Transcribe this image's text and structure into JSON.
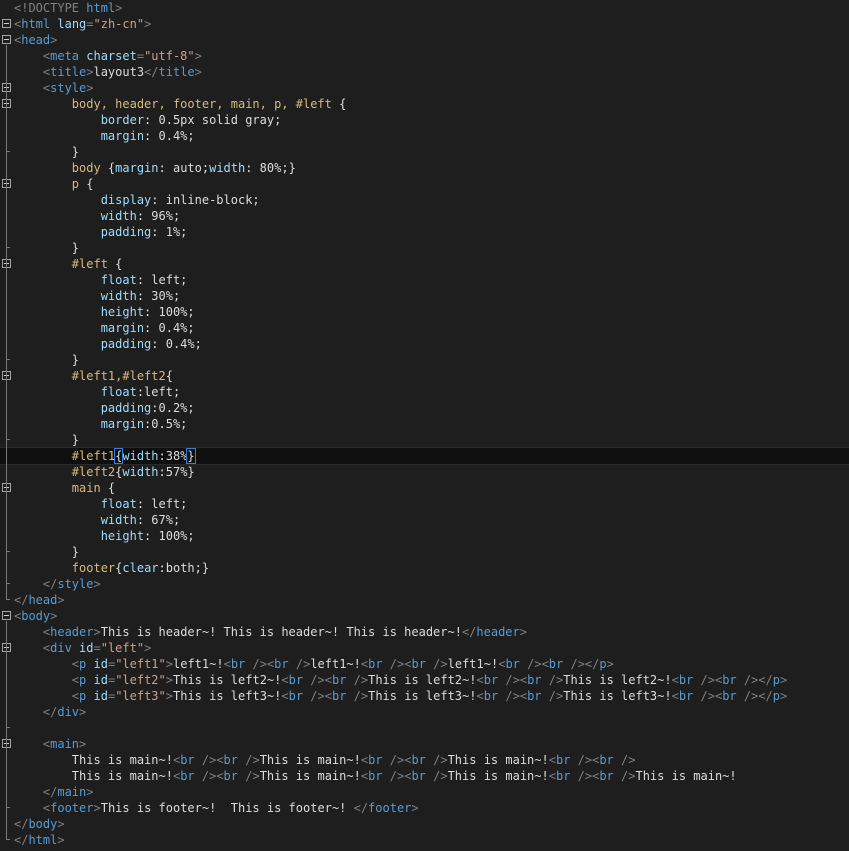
{
  "editor": {
    "lines": [
      [
        {
          "t": "<!DOCTYPE ",
          "c": "tok-punct"
        },
        {
          "t": "html",
          "c": "tok-tag"
        },
        {
          "t": ">",
          "c": "tok-punct"
        }
      ],
      [
        {
          "t": "<",
          "c": "tok-punct"
        },
        {
          "t": "html",
          "c": "tok-tag"
        },
        {
          "t": " lang",
          "c": "tok-attr"
        },
        {
          "t": "=",
          "c": "tok-punct"
        },
        {
          "t": "\"zh-cn\"",
          "c": "tok-str"
        },
        {
          "t": ">",
          "c": "tok-punct"
        }
      ],
      [
        {
          "t": "<",
          "c": "tok-punct"
        },
        {
          "t": "head",
          "c": "tok-tag"
        },
        {
          "t": ">",
          "c": "tok-punct"
        }
      ],
      [
        {
          "t": "    <",
          "c": "tok-punct"
        },
        {
          "t": "meta",
          "c": "tok-tag"
        },
        {
          "t": " charset",
          "c": "tok-attr"
        },
        {
          "t": "=",
          "c": "tok-punct"
        },
        {
          "t": "\"utf-8\"",
          "c": "tok-str"
        },
        {
          "t": ">",
          "c": "tok-punct"
        }
      ],
      [
        {
          "t": "    <",
          "c": "tok-punct"
        },
        {
          "t": "title",
          "c": "tok-tag"
        },
        {
          "t": ">",
          "c": "tok-punct"
        },
        {
          "t": "layout3",
          "c": "tok-text"
        },
        {
          "t": "</",
          "c": "tok-punct"
        },
        {
          "t": "title",
          "c": "tok-tag"
        },
        {
          "t": ">",
          "c": "tok-punct"
        }
      ],
      [
        {
          "t": "    <",
          "c": "tok-punct"
        },
        {
          "t": "style",
          "c": "tok-tag"
        },
        {
          "t": ">",
          "c": "tok-punct"
        }
      ],
      [
        {
          "t": "        body, header, footer, main, p, #left ",
          "c": "tok-sel"
        },
        {
          "t": "{",
          "c": "tok-val"
        }
      ],
      [
        {
          "t": "            border",
          "c": "tok-prop"
        },
        {
          "t": ": 0.5px solid gray;",
          "c": "tok-val"
        }
      ],
      [
        {
          "t": "            margin",
          "c": "tok-prop"
        },
        {
          "t": ": 0.4%;",
          "c": "tok-val"
        }
      ],
      [
        {
          "t": "        }",
          "c": "tok-val"
        }
      ],
      [
        {
          "t": "        body ",
          "c": "tok-sel"
        },
        {
          "t": "{",
          "c": "tok-val"
        },
        {
          "t": "margin",
          "c": "tok-prop"
        },
        {
          "t": ": auto;",
          "c": "tok-val"
        },
        {
          "t": "width",
          "c": "tok-prop"
        },
        {
          "t": ": 80%;}",
          "c": "tok-val"
        }
      ],
      [
        {
          "t": "        p ",
          "c": "tok-sel"
        },
        {
          "t": "{",
          "c": "tok-val"
        }
      ],
      [
        {
          "t": "            display",
          "c": "tok-prop"
        },
        {
          "t": ": inline-block;",
          "c": "tok-val"
        }
      ],
      [
        {
          "t": "            width",
          "c": "tok-prop"
        },
        {
          "t": ": 96%;",
          "c": "tok-val"
        }
      ],
      [
        {
          "t": "            padding",
          "c": "tok-prop"
        },
        {
          "t": ": 1%;",
          "c": "tok-val"
        }
      ],
      [
        {
          "t": "        }",
          "c": "tok-val"
        }
      ],
      [
        {
          "t": "        #left ",
          "c": "tok-sel"
        },
        {
          "t": "{",
          "c": "tok-val"
        }
      ],
      [
        {
          "t": "            float",
          "c": "tok-prop"
        },
        {
          "t": ": left;",
          "c": "tok-val"
        }
      ],
      [
        {
          "t": "            width",
          "c": "tok-prop"
        },
        {
          "t": ": 30%;",
          "c": "tok-val"
        }
      ],
      [
        {
          "t": "            height",
          "c": "tok-prop"
        },
        {
          "t": ": 100%;",
          "c": "tok-val"
        }
      ],
      [
        {
          "t": "            margin",
          "c": "tok-prop"
        },
        {
          "t": ": 0.4%;",
          "c": "tok-val"
        }
      ],
      [
        {
          "t": "            padding",
          "c": "tok-prop"
        },
        {
          "t": ": 0.4%;",
          "c": "tok-val"
        }
      ],
      [
        {
          "t": "        }",
          "c": "tok-val"
        }
      ],
      [
        {
          "t": "        #left1,#left2",
          "c": "tok-sel"
        },
        {
          "t": "{",
          "c": "tok-val"
        }
      ],
      [
        {
          "t": "            float",
          "c": "tok-prop"
        },
        {
          "t": ":left;",
          "c": "tok-val"
        }
      ],
      [
        {
          "t": "            padding",
          "c": "tok-prop"
        },
        {
          "t": ":0.2%;",
          "c": "tok-val"
        }
      ],
      [
        {
          "t": "            margin",
          "c": "tok-prop"
        },
        {
          "t": ":0.5%;",
          "c": "tok-val"
        }
      ],
      [
        {
          "t": "        }",
          "c": "tok-val"
        }
      ],
      [
        {
          "t": "        #left1",
          "c": "tok-sel"
        },
        {
          "t": "{",
          "c": "tok-val tok-brace-hl"
        },
        {
          "t": "width",
          "c": "tok-prop"
        },
        {
          "t": ":38%",
          "c": "tok-val"
        },
        {
          "t": "}",
          "c": "tok-val tok-brace-hl"
        }
      ],
      [
        {
          "t": "        #left2",
          "c": "tok-sel"
        },
        {
          "t": "{",
          "c": "tok-val"
        },
        {
          "t": "width",
          "c": "tok-prop"
        },
        {
          "t": ":57%}",
          "c": "tok-val"
        }
      ],
      [
        {
          "t": "        main ",
          "c": "tok-sel"
        },
        {
          "t": "{",
          "c": "tok-val"
        }
      ],
      [
        {
          "t": "            float",
          "c": "tok-prop"
        },
        {
          "t": ": left;",
          "c": "tok-val"
        }
      ],
      [
        {
          "t": "            width",
          "c": "tok-prop"
        },
        {
          "t": ": 67%;",
          "c": "tok-val"
        }
      ],
      [
        {
          "t": "            height",
          "c": "tok-prop"
        },
        {
          "t": ": 100%;",
          "c": "tok-val"
        }
      ],
      [
        {
          "t": "        }",
          "c": "tok-val"
        }
      ],
      [
        {
          "t": "        footer",
          "c": "tok-sel"
        },
        {
          "t": "{",
          "c": "tok-val"
        },
        {
          "t": "clear",
          "c": "tok-prop"
        },
        {
          "t": ":both;}",
          "c": "tok-val"
        }
      ],
      [
        {
          "t": "    </",
          "c": "tok-punct"
        },
        {
          "t": "style",
          "c": "tok-tag"
        },
        {
          "t": ">",
          "c": "tok-punct"
        }
      ],
      [
        {
          "t": "</",
          "c": "tok-punct"
        },
        {
          "t": "head",
          "c": "tok-tag"
        },
        {
          "t": ">",
          "c": "tok-punct"
        }
      ],
      [
        {
          "t": "<",
          "c": "tok-punct"
        },
        {
          "t": "body",
          "c": "tok-tag"
        },
        {
          "t": ">",
          "c": "tok-punct"
        }
      ],
      [
        {
          "t": "    <",
          "c": "tok-punct"
        },
        {
          "t": "header",
          "c": "tok-tag"
        },
        {
          "t": ">",
          "c": "tok-punct"
        },
        {
          "t": "This is header~! This is header~! This is header~!",
          "c": "tok-text"
        },
        {
          "t": "</",
          "c": "tok-punct"
        },
        {
          "t": "header",
          "c": "tok-tag"
        },
        {
          "t": ">",
          "c": "tok-punct"
        }
      ],
      [
        {
          "t": "    <",
          "c": "tok-punct"
        },
        {
          "t": "div",
          "c": "tok-tag"
        },
        {
          "t": " id",
          "c": "tok-attr"
        },
        {
          "t": "=",
          "c": "tok-punct"
        },
        {
          "t": "\"left\"",
          "c": "tok-str"
        },
        {
          "t": ">",
          "c": "tok-punct"
        }
      ],
      [
        {
          "t": "        <",
          "c": "tok-punct"
        },
        {
          "t": "p",
          "c": "tok-tag"
        },
        {
          "t": " id",
          "c": "tok-attr"
        },
        {
          "t": "=",
          "c": "tok-punct"
        },
        {
          "t": "\"left1\"",
          "c": "tok-str"
        },
        {
          "t": ">",
          "c": "tok-punct"
        },
        {
          "t": "left1~!",
          "c": "tok-text"
        },
        {
          "t": "<",
          "c": "tok-punct"
        },
        {
          "t": "br",
          "c": "tok-tag"
        },
        {
          "t": " /><",
          "c": "tok-punct"
        },
        {
          "t": "br",
          "c": "tok-tag"
        },
        {
          "t": " />",
          "c": "tok-punct"
        },
        {
          "t": "left1~!",
          "c": "tok-text"
        },
        {
          "t": "<",
          "c": "tok-punct"
        },
        {
          "t": "br",
          "c": "tok-tag"
        },
        {
          "t": " /><",
          "c": "tok-punct"
        },
        {
          "t": "br",
          "c": "tok-tag"
        },
        {
          "t": " />",
          "c": "tok-punct"
        },
        {
          "t": "left1~!",
          "c": "tok-text"
        },
        {
          "t": "<",
          "c": "tok-punct"
        },
        {
          "t": "br",
          "c": "tok-tag"
        },
        {
          "t": " /><",
          "c": "tok-punct"
        },
        {
          "t": "br",
          "c": "tok-tag"
        },
        {
          "t": " /></",
          "c": "tok-punct"
        },
        {
          "t": "p",
          "c": "tok-tag"
        },
        {
          "t": ">",
          "c": "tok-punct"
        }
      ],
      [
        {
          "t": "        <",
          "c": "tok-punct"
        },
        {
          "t": "p",
          "c": "tok-tag"
        },
        {
          "t": " id",
          "c": "tok-attr"
        },
        {
          "t": "=",
          "c": "tok-punct"
        },
        {
          "t": "\"left2\"",
          "c": "tok-str"
        },
        {
          "t": ">",
          "c": "tok-punct"
        },
        {
          "t": "This is left2~!",
          "c": "tok-text"
        },
        {
          "t": "<",
          "c": "tok-punct"
        },
        {
          "t": "br",
          "c": "tok-tag"
        },
        {
          "t": " /><",
          "c": "tok-punct"
        },
        {
          "t": "br",
          "c": "tok-tag"
        },
        {
          "t": " />",
          "c": "tok-punct"
        },
        {
          "t": "This is left2~!",
          "c": "tok-text"
        },
        {
          "t": "<",
          "c": "tok-punct"
        },
        {
          "t": "br",
          "c": "tok-tag"
        },
        {
          "t": " /><",
          "c": "tok-punct"
        },
        {
          "t": "br",
          "c": "tok-tag"
        },
        {
          "t": " />",
          "c": "tok-punct"
        },
        {
          "t": "This is left2~!",
          "c": "tok-text"
        },
        {
          "t": "<",
          "c": "tok-punct"
        },
        {
          "t": "br",
          "c": "tok-tag"
        },
        {
          "t": " /><",
          "c": "tok-punct"
        },
        {
          "t": "br",
          "c": "tok-tag"
        },
        {
          "t": " /></",
          "c": "tok-punct"
        },
        {
          "t": "p",
          "c": "tok-tag"
        },
        {
          "t": ">",
          "c": "tok-punct"
        }
      ],
      [
        {
          "t": "        <",
          "c": "tok-punct"
        },
        {
          "t": "p",
          "c": "tok-tag"
        },
        {
          "t": " id",
          "c": "tok-attr"
        },
        {
          "t": "=",
          "c": "tok-punct"
        },
        {
          "t": "\"left3\"",
          "c": "tok-str"
        },
        {
          "t": ">",
          "c": "tok-punct"
        },
        {
          "t": "This is left3~!",
          "c": "tok-text"
        },
        {
          "t": "<",
          "c": "tok-punct"
        },
        {
          "t": "br",
          "c": "tok-tag"
        },
        {
          "t": " /><",
          "c": "tok-punct"
        },
        {
          "t": "br",
          "c": "tok-tag"
        },
        {
          "t": " />",
          "c": "tok-punct"
        },
        {
          "t": "This is left3~!",
          "c": "tok-text"
        },
        {
          "t": "<",
          "c": "tok-punct"
        },
        {
          "t": "br",
          "c": "tok-tag"
        },
        {
          "t": " /><",
          "c": "tok-punct"
        },
        {
          "t": "br",
          "c": "tok-tag"
        },
        {
          "t": " />",
          "c": "tok-punct"
        },
        {
          "t": "This is left3~!",
          "c": "tok-text"
        },
        {
          "t": "<",
          "c": "tok-punct"
        },
        {
          "t": "br",
          "c": "tok-tag"
        },
        {
          "t": " /><",
          "c": "tok-punct"
        },
        {
          "t": "br",
          "c": "tok-tag"
        },
        {
          "t": " /></",
          "c": "tok-punct"
        },
        {
          "t": "p",
          "c": "tok-tag"
        },
        {
          "t": ">",
          "c": "tok-punct"
        }
      ],
      [
        {
          "t": "    </",
          "c": "tok-punct"
        },
        {
          "t": "div",
          "c": "tok-tag"
        },
        {
          "t": ">",
          "c": "tok-punct"
        }
      ],
      [],
      [
        {
          "t": "    <",
          "c": "tok-punct"
        },
        {
          "t": "main",
          "c": "tok-tag"
        },
        {
          "t": ">",
          "c": "tok-punct"
        }
      ],
      [
        {
          "t": "        This is main~!",
          "c": "tok-text"
        },
        {
          "t": "<",
          "c": "tok-punct"
        },
        {
          "t": "br",
          "c": "tok-tag"
        },
        {
          "t": " /><",
          "c": "tok-punct"
        },
        {
          "t": "br",
          "c": "tok-tag"
        },
        {
          "t": " />",
          "c": "tok-punct"
        },
        {
          "t": "This is main~!",
          "c": "tok-text"
        },
        {
          "t": "<",
          "c": "tok-punct"
        },
        {
          "t": "br",
          "c": "tok-tag"
        },
        {
          "t": " /><",
          "c": "tok-punct"
        },
        {
          "t": "br",
          "c": "tok-tag"
        },
        {
          "t": " />",
          "c": "tok-punct"
        },
        {
          "t": "This is main~!",
          "c": "tok-text"
        },
        {
          "t": "<",
          "c": "tok-punct"
        },
        {
          "t": "br",
          "c": "tok-tag"
        },
        {
          "t": " /><",
          "c": "tok-punct"
        },
        {
          "t": "br",
          "c": "tok-tag"
        },
        {
          "t": " />",
          "c": "tok-punct"
        }
      ],
      [
        {
          "t": "        This is main~!",
          "c": "tok-text"
        },
        {
          "t": "<",
          "c": "tok-punct"
        },
        {
          "t": "br",
          "c": "tok-tag"
        },
        {
          "t": " /><",
          "c": "tok-punct"
        },
        {
          "t": "br",
          "c": "tok-tag"
        },
        {
          "t": " />",
          "c": "tok-punct"
        },
        {
          "t": "This is main~!",
          "c": "tok-text"
        },
        {
          "t": "<",
          "c": "tok-punct"
        },
        {
          "t": "br",
          "c": "tok-tag"
        },
        {
          "t": " /><",
          "c": "tok-punct"
        },
        {
          "t": "br",
          "c": "tok-tag"
        },
        {
          "t": " />",
          "c": "tok-punct"
        },
        {
          "t": "This is main~!",
          "c": "tok-text"
        },
        {
          "t": "<",
          "c": "tok-punct"
        },
        {
          "t": "br",
          "c": "tok-tag"
        },
        {
          "t": " /><",
          "c": "tok-punct"
        },
        {
          "t": "br",
          "c": "tok-tag"
        },
        {
          "t": " />",
          "c": "tok-punct"
        },
        {
          "t": "This is main~!",
          "c": "tok-text"
        }
      ],
      [
        {
          "t": "    </",
          "c": "tok-punct"
        },
        {
          "t": "main",
          "c": "tok-tag"
        },
        {
          "t": ">",
          "c": "tok-punct"
        }
      ],
      [
        {
          "t": "    <",
          "c": "tok-punct"
        },
        {
          "t": "footer",
          "c": "tok-tag"
        },
        {
          "t": ">",
          "c": "tok-punct"
        },
        {
          "t": "This is footer~!  This is footer~! ",
          "c": "tok-text"
        },
        {
          "t": "</",
          "c": "tok-punct"
        },
        {
          "t": "footer",
          "c": "tok-tag"
        },
        {
          "t": ">",
          "c": "tok-punct"
        }
      ],
      [
        {
          "t": "</",
          "c": "tok-punct"
        },
        {
          "t": "body",
          "c": "tok-tag"
        },
        {
          "t": ">",
          "c": "tok-punct"
        }
      ],
      [
        {
          "t": "</",
          "c": "tok-punct"
        },
        {
          "t": "html",
          "c": "tok-tag"
        },
        {
          "t": ">",
          "c": "tok-punct"
        }
      ]
    ],
    "fold_lines": [
      1,
      2,
      5,
      6,
      11,
      16,
      23,
      30,
      38,
      40,
      46
    ],
    "current_line": 28,
    "colors": {
      "background": "#1e1e1e",
      "tag": "#569cd6",
      "attribute": "#9cdcfe",
      "string": "#d69d85",
      "selector": "#d7ba7d",
      "text": "#dcdcdc"
    }
  }
}
